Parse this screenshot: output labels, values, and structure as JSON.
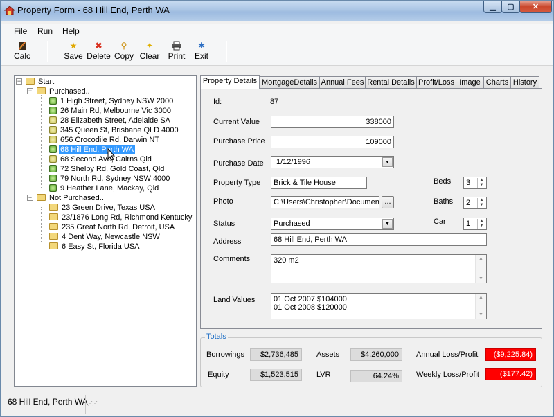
{
  "window": {
    "title": "Property Form - 68 Hill End, Perth WA"
  },
  "menu": [
    "File",
    "Run",
    "Help"
  ],
  "toolbar": {
    "calc": "Calc",
    "save": "Save",
    "delete": "Delete",
    "copy": "Copy",
    "clear": "Clear",
    "print": "Print",
    "exit": "Exit"
  },
  "tree": {
    "root": "Start",
    "purchased_label": "Purchased..",
    "purchased": [
      "1 High Street, Sydney NSW 2000",
      "26 Main Rd, Melbourne Vic 3000",
      "28 Elizabeth Street, Adelaide SA",
      "345 Queen St, Brisbane QLD 4000",
      "656 Crocodile Rd, Darwin NT",
      "68 Hill End, Perth WA",
      "68 Second Ave, Cairns Qld",
      "72 Shelby Rd, Gold Coast, Qld",
      "79 North Rd, Sydney NSW 4000",
      "9 Heather Lane, Mackay, Qld"
    ],
    "not_purchased_label": "Not Purchased..",
    "not_purchased": [
      "23 Green Drive, Texas USA",
      "23/1876 Long Rd, Richmond Kentucky",
      "235 Great North Rd, Detroit, USA",
      "4 Dent Way, Newcastle NSW",
      "6 Easy St, Florida USA"
    ]
  },
  "tabs": [
    "Property Details",
    "MortgageDetails",
    "Annual Fees",
    "Rental Details",
    "Profit/Loss",
    "Image",
    "Charts",
    "History"
  ],
  "form": {
    "id_label": "Id:",
    "id_value": "87",
    "current_value_label": "Current Value",
    "current_value": "338000",
    "purchase_price_label": "Purchase Price",
    "purchase_price": "109000",
    "purchase_date_label": "Purchase Date",
    "purchase_date": "1/12/1996",
    "property_type_label": "Property Type",
    "property_type": "Brick & Tile House",
    "photo_label": "Photo",
    "photo_path": "C:\\Users\\Christopher\\Documents\\",
    "browse": "...",
    "status_label": "Status",
    "status": "Purchased",
    "address_label": "Address",
    "address": "68 Hill End, Perth WA",
    "comments_label": "Comments",
    "comments": "320 m2",
    "land_values_label": "Land Values",
    "land_values": [
      "01 Oct 2007 $104000",
      "01 Oct 2008 $120000"
    ],
    "beds_label": "Beds",
    "beds": "3",
    "baths_label": "Baths",
    "baths": "2",
    "car_label": "Car",
    "car": "1"
  },
  "totals": {
    "legend": "Totals",
    "borrowings_label": "Borrowings",
    "borrowings": "$2,736,485",
    "equity_label": "Equity",
    "equity": "$1,523,515",
    "assets_label": "Assets",
    "assets": "$4,260,000",
    "lvr_label": "LVR",
    "lvr": "64.24%",
    "annual_label": "Annual Loss/Profit",
    "annual": "($9,225.84)",
    "weekly_label": "Weekly Loss/Profit",
    "weekly": "($177.42)"
  },
  "status_bar": {
    "text": "68 Hill End, Perth WA"
  },
  "colors": {
    "negative": "#ff0000",
    "selection": "#3399ff",
    "totals_legend": "#1a6cc4"
  }
}
